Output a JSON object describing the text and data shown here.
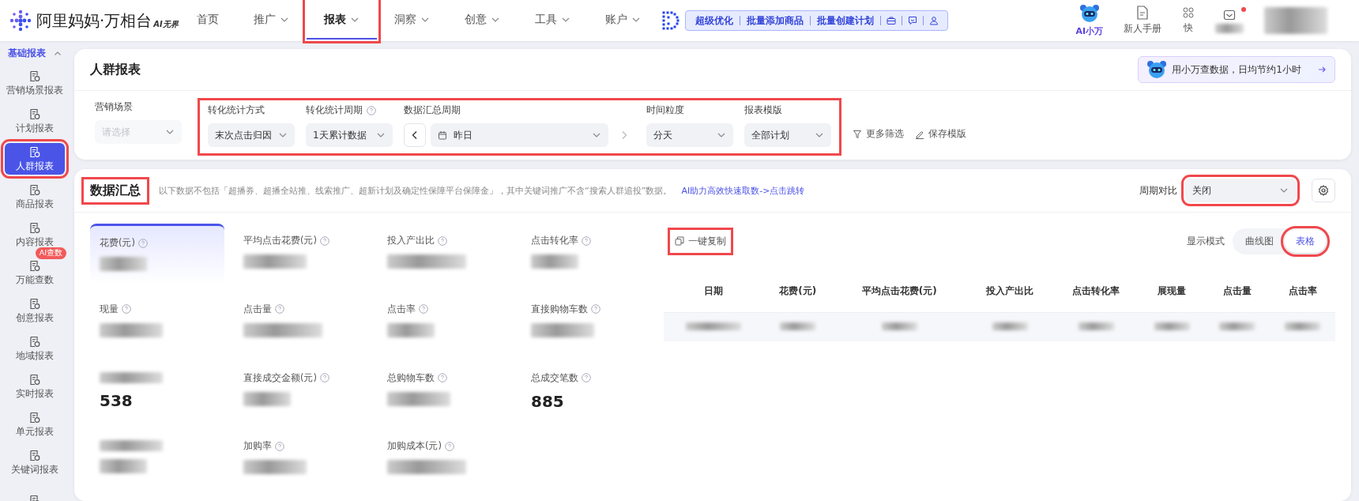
{
  "nav": {
    "brand": "阿里妈妈·万相台",
    "brand_tag": "AI无界",
    "items": [
      {
        "label": "首页",
        "dropdown": false,
        "selected": false,
        "highlighted": false
      },
      {
        "label": "推广",
        "dropdown": true,
        "selected": false,
        "highlighted": false
      },
      {
        "label": "报表",
        "dropdown": true,
        "selected": true,
        "highlighted": true
      },
      {
        "label": "洞察",
        "dropdown": true,
        "selected": false,
        "highlighted": false
      },
      {
        "label": "创意",
        "dropdown": true,
        "selected": false,
        "highlighted": false
      },
      {
        "label": "工具",
        "dropdown": true,
        "selected": false,
        "highlighted": false
      },
      {
        "label": "账户",
        "dropdown": true,
        "selected": false,
        "highlighted": false
      }
    ]
  },
  "quick_actions": [
    {
      "kind": "text",
      "label": "超级优化"
    },
    {
      "kind": "text",
      "label": "批量添加商品"
    },
    {
      "kind": "text",
      "label": "批量创建计划"
    },
    {
      "kind": "briefcase"
    },
    {
      "kind": "chat"
    },
    {
      "kind": "person"
    }
  ],
  "header_right": [
    {
      "kind": "assistant",
      "label": "AI小万",
      "badge": false
    },
    {
      "kind": "doc",
      "label": "新人手册",
      "badge": false
    },
    {
      "kind": "grid",
      "label": "快",
      "badge": false
    },
    {
      "kind": "mail",
      "badge": true
    }
  ],
  "sidebar": {
    "section": "基础报表",
    "expanded": true,
    "items": [
      {
        "label": "营销场景报表",
        "selected": false,
        "highlighted": false
      },
      {
        "label": "计划报表",
        "selected": false,
        "highlighted": false
      },
      {
        "label": "人群报表",
        "selected": true,
        "highlighted": true
      },
      {
        "label": "商品报表",
        "selected": false,
        "highlighted": false
      },
      {
        "label": "内容报表",
        "selected": false,
        "highlighted": false
      },
      {
        "label": "万能查数",
        "selected": false,
        "highlighted": false,
        "badge": "AI查数"
      },
      {
        "label": "创意报表",
        "selected": false,
        "highlighted": false
      },
      {
        "label": "地域报表",
        "selected": false,
        "highlighted": false
      },
      {
        "label": "实时报表",
        "selected": false,
        "highlighted": false
      },
      {
        "label": "单元报表",
        "selected": false,
        "highlighted": false
      },
      {
        "label": "关键词报表",
        "selected": false,
        "highlighted": false
      },
      {
        "selected": false,
        "highlighted": false
      }
    ]
  },
  "report": {
    "title": "人群报表",
    "assistant_tip": "用小万查数据，日均节约1小时",
    "filter_groups": [
      {
        "highlighted": false,
        "filters": [
          {
            "kind": "select",
            "label": "营销场景",
            "placeholder": "请选择",
            "disabled": true,
            "help": false
          }
        ]
      },
      {
        "highlighted": true,
        "filters": [
          {
            "kind": "select",
            "label": "转化统计方式",
            "value": "末次点击归因",
            "disabled": false,
            "help": false
          },
          {
            "kind": "select",
            "label": "转化统计周期",
            "value": "1天累计数据",
            "disabled": false,
            "help": true
          },
          {
            "kind": "period",
            "label": "数据汇总周期",
            "value": "昨日",
            "disabled": false,
            "help": false
          },
          {
            "kind": "select",
            "label": "时间粒度",
            "value": "分天",
            "disabled": false,
            "help": false
          },
          {
            "kind": "select",
            "label": "报表模版",
            "value": "全部计划",
            "disabled": false,
            "help": false
          }
        ]
      }
    ],
    "actions": [
      {
        "kind": "filter",
        "label": "更多筛选"
      },
      {
        "kind": "edit",
        "label": "保存模版"
      }
    ]
  },
  "summary": {
    "title": "数据汇总",
    "title_highlighted": true,
    "note": "以下数据不包括「超播券、超播全站推、线索推广、超新计划及确定性保障平台保障金」，其中关键词推广不含“搜索人群追投”数据。",
    "link": "AI助力高效快速取数->点击跳转",
    "compare": {
      "label": "周期对比",
      "value": "关闭",
      "highlighted": true
    },
    "metrics": [
      {
        "label": "花费(元)",
        "selected": true
      },
      {
        "label": "平均点击花费(元)",
        "selected": false
      },
      {
        "label": "投入产出比",
        "selected": false
      },
      {
        "label": "点击转化率",
        "selected": false
      },
      {
        "label": "现量",
        "selected": false
      },
      {
        "label": "点击量",
        "selected": false
      },
      {
        "label": "点击率",
        "selected": false
      },
      {
        "label": "直接购物车数",
        "selected": false
      },
      {
        "value": "538",
        "selected": false
      },
      {
        "label": "直接成交金额(元)",
        "selected": false
      },
      {
        "label": "总购物车数",
        "selected": false
      },
      {
        "label": "总成交笔数",
        "value": "885",
        "selected": false
      },
      {
        "selected": false
      },
      {
        "label": "加购率",
        "selected": false
      },
      {
        "label": "加购成本(元)",
        "selected": false
      }
    ],
    "copy": {
      "label": "一键复制",
      "highlighted": true
    },
    "view_mode": {
      "label": "显示模式",
      "options": [
        {
          "label": "曲线图",
          "selected": false,
          "highlighted": false
        },
        {
          "label": "表格",
          "selected": true,
          "highlighted": true
        }
      ]
    },
    "table": {
      "columns": [
        "日期",
        "花费(元)",
        "平均点击花费(元)",
        "投入产出比",
        "点击转化率",
        "展现量",
        "点击量",
        "点击率"
      ],
      "rows": [
        {
          "kind": "redacted"
        }
      ]
    }
  }
}
